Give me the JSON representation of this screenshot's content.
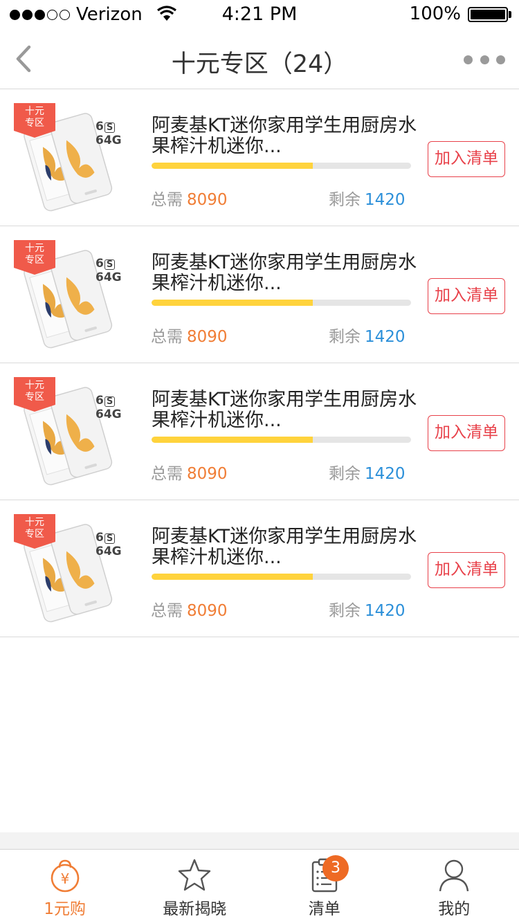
{
  "status_bar": {
    "carrier": "Verizon",
    "time": "4:21 PM",
    "battery": "100%"
  },
  "nav": {
    "title": "十元专区（24）"
  },
  "items": [
    {
      "tag": "十元\n专区",
      "model_prefix": "6",
      "model_s": "S",
      "model_storage": "64G",
      "title": "阿麦基KT迷你家用学生用厨房水果榨汁机迷你...",
      "progress": 0.62,
      "total_label": "总需",
      "total_value": "8090",
      "remain_label": "剩余",
      "remain_value": "1420",
      "button": "加入清单"
    },
    {
      "tag": "十元\n专区",
      "model_prefix": "6",
      "model_s": "S",
      "model_storage": "64G",
      "title": "阿麦基KT迷你家用学生用厨房水果榨汁机迷你...",
      "progress": 0.62,
      "total_label": "总需",
      "total_value": "8090",
      "remain_label": "剩余",
      "remain_value": "1420",
      "button": "加入清单"
    },
    {
      "tag": "十元\n专区",
      "model_prefix": "6",
      "model_s": "S",
      "model_storage": "64G",
      "title": "阿麦基KT迷你家用学生用厨房水果榨汁机迷你...",
      "progress": 0.62,
      "total_label": "总需",
      "total_value": "8090",
      "remain_label": "剩余",
      "remain_value": "1420",
      "button": "加入清单"
    },
    {
      "tag": "十元\n专区",
      "model_prefix": "6",
      "model_s": "S",
      "model_storage": "64G",
      "title": "阿麦基KT迷你家用学生用厨房水果榨汁机迷你...",
      "progress": 0.62,
      "total_label": "总需",
      "total_value": "8090",
      "remain_label": "剩余",
      "remain_value": "1420",
      "button": "加入清单"
    }
  ],
  "tabs": [
    {
      "label": "1元购",
      "icon": "yuan-bag-icon",
      "active": true
    },
    {
      "label": "最新揭晓",
      "icon": "star-icon",
      "active": false
    },
    {
      "label": "清单",
      "icon": "list-icon",
      "active": false,
      "badge": "3"
    },
    {
      "label": "我的",
      "icon": "user-icon",
      "active": false
    }
  ],
  "colors": {
    "accent_orange": "#f07d35",
    "remain_blue": "#2b8fd9",
    "button_red": "#e8414a",
    "progress_yellow": "#ffd33c",
    "tag_red": "#f05a4a"
  }
}
